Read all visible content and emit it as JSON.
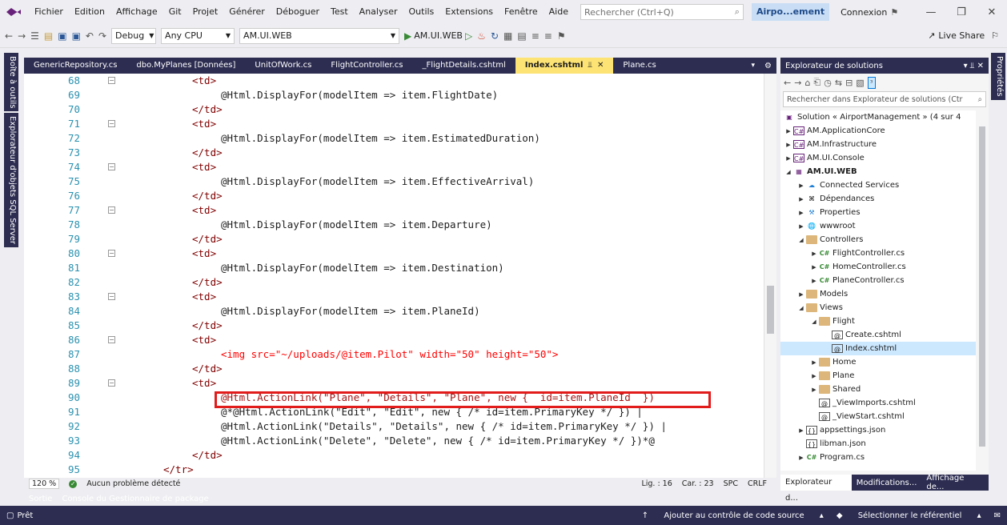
{
  "menubar": {
    "items": [
      "Fichier",
      "Edition",
      "Affichage",
      "Git",
      "Projet",
      "Générer",
      "Déboguer",
      "Test",
      "Analyser",
      "Outils",
      "Extensions",
      "Fenêtre",
      "Aide"
    ],
    "search_placeholder": "Rechercher (Ctrl+Q)",
    "app_title": "Airpo...ement",
    "connect": "Connexion"
  },
  "toolbar": {
    "config": "Debug",
    "platform": "Any CPU",
    "project": "AM.UI.WEB",
    "run_target": "AM.UI.WEB",
    "live_share": "Live Share"
  },
  "left_strip": [
    "Boîte à outils",
    "Explorateur d'objets SQL Server"
  ],
  "right_strip": [
    "Propriétés"
  ],
  "tabs": [
    {
      "label": "GenericRepository.cs"
    },
    {
      "label": "dbo.MyPlanes [Données]"
    },
    {
      "label": "UnitOfWork.cs"
    },
    {
      "label": "FlightController.cs"
    },
    {
      "label": "_FlightDetails.cshtml"
    },
    {
      "label": "Index.cshtml"
    },
    {
      "label": "Plane.cs"
    }
  ],
  "code": {
    "line_numbers": [
      "68",
      "69",
      "70",
      "71",
      "72",
      "73",
      "74",
      "75",
      "76",
      "77",
      "78",
      "79",
      "80",
      "81",
      "82",
      "83",
      "84",
      "85",
      "86",
      "87",
      "88",
      "89",
      "90",
      "91",
      "92",
      "93",
      "94",
      "95"
    ],
    "l68": "<td>",
    "l69": "@Html.DisplayFor(modelItem => item.FlightDate)",
    "l70": "</td>",
    "l71": "<td>",
    "l72": "@Html.DisplayFor(modelItem => item.EstimatedDuration)",
    "l73": "</td>",
    "l74": "<td>",
    "l75": "@Html.DisplayFor(modelItem => item.EffectiveArrival)",
    "l76": "</td>",
    "l77": "<td>",
    "l78": "@Html.DisplayFor(modelItem => item.Departure)",
    "l79": "</td>",
    "l80": "<td>",
    "l81": "@Html.DisplayFor(modelItem => item.Destination)",
    "l82": "</td>",
    "l83": "<td>",
    "l84": "@Html.DisplayFor(modelItem => item.PlaneId)",
    "l85": "</td>",
    "l86": "<td>",
    "l87": "<img src=\"~/uploads/@item.Pilot\" width=\"50\" height=\"50\">",
    "l88": "</td>",
    "l89": "<td>",
    "l90": "@Html.ActionLink(\"Plane\", \"Details\", \"Plane\", new {  id=item.PlaneId  })",
    "l91": "@*@Html.ActionLink(\"Edit\", \"Edit\", new { /* id=item.PrimaryKey */ }) |",
    "l92": "@Html.ActionLink(\"Details\", \"Details\", new { /* id=item.PrimaryKey */ }) |",
    "l93": "@Html.ActionLink(\"Delete\", \"Delete\", new { /* id=item.PrimaryKey */ })*@",
    "l94": "</td>",
    "l95": "</tr>"
  },
  "editor_status": {
    "zoom": "120 %",
    "problems": "Aucun problème détecté",
    "line": "Lig. : 16",
    "col": "Car. : 23",
    "spc": "SPC",
    "crlf": "CRLF"
  },
  "bottom_tabs": [
    "Sortie",
    "Console du Gestionnaire de package"
  ],
  "solution_explorer": {
    "title": "Explorateur de solutions",
    "search_placeholder": "Rechercher dans Explorateur de solutions (Ctr",
    "nodes": [
      {
        "label": "Solution « AirportManagement » (4 sur 4",
        "indent": 0
      },
      {
        "label": "AM.ApplicationCore",
        "indent": 0
      },
      {
        "label": "AM.Infrastructure",
        "indent": 0
      },
      {
        "label": "AM.UI.Console",
        "indent": 0
      },
      {
        "label": "AM.UI.WEB",
        "indent": 0
      },
      {
        "label": "Connected Services",
        "indent": 1
      },
      {
        "label": "Dépendances",
        "indent": 1
      },
      {
        "label": "Properties",
        "indent": 1
      },
      {
        "label": "wwwroot",
        "indent": 1
      },
      {
        "label": "Controllers",
        "indent": 1
      },
      {
        "label": "FlightController.cs",
        "indent": 2
      },
      {
        "label": "HomeController.cs",
        "indent": 2
      },
      {
        "label": "PlaneController.cs",
        "indent": 2
      },
      {
        "label": "Models",
        "indent": 1
      },
      {
        "label": "Views",
        "indent": 1
      },
      {
        "label": "Flight",
        "indent": 2
      },
      {
        "label": "Create.cshtml",
        "indent": 3
      },
      {
        "label": "Index.cshtml",
        "indent": 3
      },
      {
        "label": "Home",
        "indent": 2
      },
      {
        "label": "Plane",
        "indent": 2
      },
      {
        "label": "Shared",
        "indent": 2
      },
      {
        "label": "_ViewImports.cshtml",
        "indent": 2
      },
      {
        "label": "_ViewStart.cshtml",
        "indent": 2
      },
      {
        "label": "appsettings.json",
        "indent": 1
      },
      {
        "label": "libman.json",
        "indent": 1
      },
      {
        "label": "Program.cs",
        "indent": 1
      }
    ],
    "bottom_tabs": [
      "Explorateur d...",
      "Modifications...",
      "Affichage de..."
    ]
  },
  "statusbar": {
    "ready": "Prêt",
    "source_control": "Ajouter au contrôle de code source",
    "repo": "Sélectionner le référentiel"
  }
}
